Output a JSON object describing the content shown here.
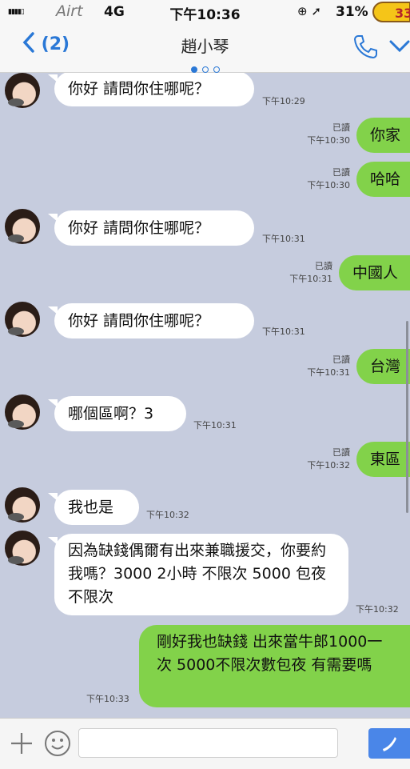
{
  "status": {
    "carrier": "Airt",
    "network": "4G",
    "time": "下午10:36",
    "battery": "31%",
    "badge": "33"
  },
  "header": {
    "back_label": "(2)",
    "title": "趙小琴"
  },
  "messages": [
    {
      "dir": "in",
      "text": "你好 請問你住哪呢？",
      "time": "下午10:29"
    },
    {
      "dir": "out",
      "text": "你家",
      "read": "已讀",
      "time": "下午10:30"
    },
    {
      "dir": "out",
      "text": "哈哈",
      "read": "已讀",
      "time": "下午10:30"
    },
    {
      "dir": "in",
      "text": "你好 請問你住哪呢？",
      "time": "下午10:31"
    },
    {
      "dir": "out",
      "text": "中國人",
      "read": "已讀",
      "time": "下午10:31"
    },
    {
      "dir": "in",
      "text": "你好 請問你住哪呢？",
      "time": "下午10:31"
    },
    {
      "dir": "out",
      "text": "台灣",
      "read": "已讀",
      "time": "下午10:31"
    },
    {
      "dir": "in",
      "text": "哪個區啊？3",
      "time": "下午10:31"
    },
    {
      "dir": "out",
      "text": "東區",
      "read": "已讀",
      "time": "下午10:32"
    },
    {
      "dir": "in",
      "text": "我也是",
      "time": "下午10:32"
    },
    {
      "dir": "in",
      "text": "因為缺錢偶爾有出來兼職援交，你要約我嗎？3000 2小時 不限次 5000 包夜 不限次",
      "time": "下午10:32"
    },
    {
      "dir": "out",
      "text": "剛好我也缺錢 出來當牛郎1000一次 5000不限次數包夜 有需要嗎",
      "time": "下午10:33"
    }
  ],
  "icons": {
    "back": "chevron-left-icon",
    "call": "phone-icon",
    "more": "chevron-down-icon",
    "attach": "plus-icon",
    "sticker": "smiley-icon",
    "send": "send-icon"
  },
  "colors": {
    "accent": "#2a78d6",
    "chat_bg": "#c6ccde",
    "outgoing": "#82d24a",
    "incoming": "#ffffff",
    "send": "#4a86e8"
  }
}
